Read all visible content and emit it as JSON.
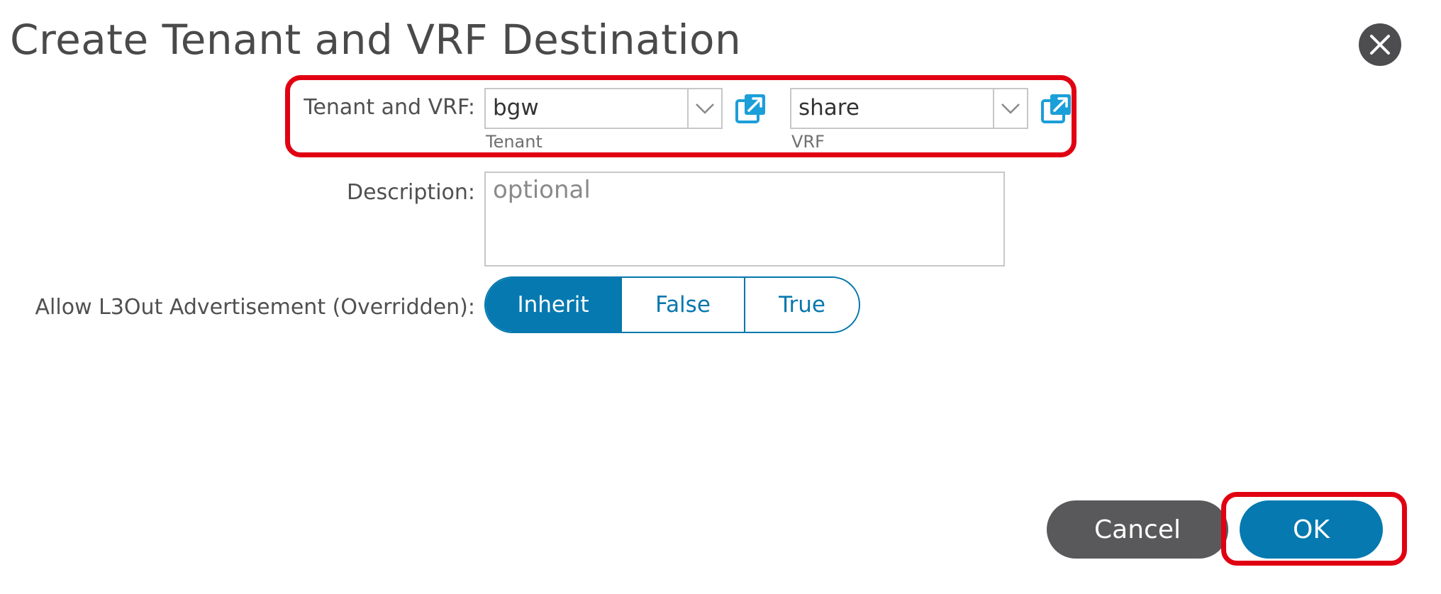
{
  "dialog": {
    "title": "Create Tenant and VRF Destination"
  },
  "tenant_vrf": {
    "label": "Tenant and VRF:",
    "tenant_value": "bgw",
    "tenant_sublabel": "Tenant",
    "vrf_value": "share",
    "vrf_sublabel": "VRF"
  },
  "description": {
    "label": "Description:",
    "placeholder": "optional",
    "value": ""
  },
  "advertisement": {
    "label": "Allow L3Out Advertisement (Overridden):",
    "options": [
      "Inherit",
      "False",
      "True"
    ],
    "selected": "Inherit"
  },
  "buttons": {
    "cancel_label": "Cancel",
    "ok_label": "OK"
  },
  "icons": {
    "close": "close-icon",
    "dropdown": "chevron-down-icon",
    "popout": "external-link-icon"
  },
  "colors": {
    "primary": "#0579b0",
    "secondary_button": "#59595b",
    "highlight": "#e10012",
    "popout_icon": "#1a9fd9"
  }
}
